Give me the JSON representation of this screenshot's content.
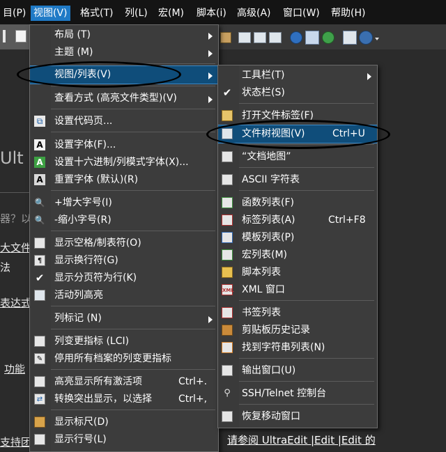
{
  "menubar": {
    "items": [
      {
        "label": "目(P)"
      },
      {
        "label": "视图(V)"
      },
      {
        "label": "格式(T)"
      },
      {
        "label": "列(L)"
      },
      {
        "label": "宏(M)"
      },
      {
        "label": "脚本(i)"
      },
      {
        "label": "高级(A)"
      },
      {
        "label": "窗口(W)"
      },
      {
        "label": "帮助(H)"
      }
    ]
  },
  "background_text": {
    "line1": "Ult",
    "line2": "器？以",
    "line3": "大文件",
    "line4": "法",
    "line5": "表达式",
    "line6": "功能",
    "line7": "支持团"
  },
  "view_menu": {
    "items": [
      {
        "label": "布局 (T)",
        "icon": "",
        "submenu": true
      },
      {
        "label": "主题 (M)",
        "icon": "",
        "submenu": true
      },
      {
        "label": "视图/列表(V)",
        "icon": "",
        "submenu": true,
        "highlighted": true
      },
      {
        "label": "查看方式 (高亮文件类型)(V)",
        "icon": "",
        "submenu": true
      },
      {
        "label": "设置代码页...",
        "icon": "codepage-icon"
      },
      {
        "label": "设置字体(F)...",
        "icon": "font-icon"
      },
      {
        "label": "设置十六进制/列模式字体(X)...",
        "icon": "hex-font-icon"
      },
      {
        "label": "重置字体 (默认)(R)",
        "icon": "reset-font-icon"
      },
      {
        "label": "+增大字号(I)",
        "icon": "zoom-in-icon"
      },
      {
        "label": "-缩小字号(R)",
        "icon": "zoom-out-icon"
      },
      {
        "label": "显示空格/制表符(O)",
        "icon": "show-spaces-icon"
      },
      {
        "label": "显示换行符(G)",
        "icon": "show-linebreaks-icon"
      },
      {
        "label": "显示分页符为行(K)",
        "icon": "check-icon",
        "checked": true
      },
      {
        "label": "活动列高亮",
        "icon": "column-highlight-icon"
      },
      {
        "label": "列标记 (N)",
        "icon": "",
        "submenu": true
      },
      {
        "label": "列变更指标 (LCI)",
        "icon": "lci-icon"
      },
      {
        "label": "停用所有档案的列变更指标",
        "icon": "disable-lci-icon"
      },
      {
        "label": "高亮显示所有激活项",
        "icon": "highlight-all-icon",
        "shortcut": "Ctrl+."
      },
      {
        "label": "转换突出显示，以选择",
        "icon": "convert-highlight-icon",
        "shortcut": "Ctrl+,"
      },
      {
        "label": "显示标尺(D)",
        "icon": "ruler-icon"
      },
      {
        "label": "显示行号(L)",
        "icon": "line-numbers-icon"
      }
    ]
  },
  "views_submenu": {
    "items": [
      {
        "label": "工具栏(T)",
        "icon": "",
        "submenu": true
      },
      {
        "label": "状态栏(S)",
        "icon": "check-icon",
        "checked": true
      },
      {
        "label": "打开文件标签(F)",
        "icon": "file-tabs-icon"
      },
      {
        "label": "文件树视图(V)",
        "icon": "file-tree-icon",
        "shortcut": "Ctrl+U",
        "highlighted": true
      },
      {
        "label": "“文档地图”",
        "icon": "document-map-icon"
      },
      {
        "label": "ASCII 字符表",
        "icon": "ascii-table-icon"
      },
      {
        "label": "函数列表(F)",
        "icon": "function-list-icon"
      },
      {
        "label": "标签列表(A)",
        "icon": "tag-list-icon",
        "shortcut": "Ctrl+F8"
      },
      {
        "label": "模板列表(P)",
        "icon": "template-list-icon"
      },
      {
        "label": "宏列表(M)",
        "icon": "macro-list-icon"
      },
      {
        "label": "脚本列表",
        "icon": "script-list-icon"
      },
      {
        "label": "XML 窗口",
        "icon": "xml-window-icon"
      },
      {
        "label": "书签列表",
        "icon": "bookmark-list-icon"
      },
      {
        "label": "剪贴板历史记录",
        "icon": "clipboard-history-icon"
      },
      {
        "label": "找到字符串列表(N)",
        "icon": "find-string-list-icon"
      },
      {
        "label": "输出窗口(U)",
        "icon": "output-window-icon"
      },
      {
        "label": "SSH/Telnet 控制台",
        "icon": "ssh-console-icon"
      },
      {
        "label": "恢复移动窗口",
        "icon": "restore-window-icon"
      }
    ]
  },
  "status_link": "请参阅 UltraEdit |Edit |Edit 的"
}
